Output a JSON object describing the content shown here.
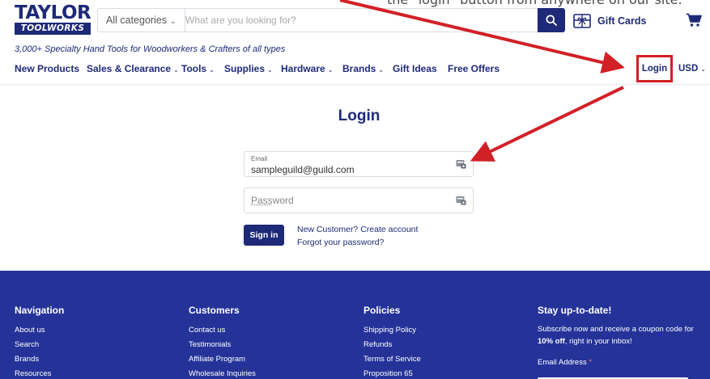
{
  "brand": {
    "logo_top": "TAYLOR",
    "logo_bottom": "TOOLWORKS",
    "tagline": "3,000+ Specialty Hand Tools for Woodworkers & Crafters of all types"
  },
  "search": {
    "category_label": "All categories",
    "placeholder": "What are you looking for?"
  },
  "header": {
    "gift_cards_label": "Gift Cards",
    "login_label": "Login",
    "currency_label": "USD"
  },
  "tip": {
    "text": "the \"login\" button from anywhere on our site."
  },
  "nav": {
    "items": [
      {
        "label": "New Products"
      },
      {
        "label": "Sales & Clearance"
      },
      {
        "label": "Tools"
      },
      {
        "label": "Supplies"
      },
      {
        "label": "Hardware"
      },
      {
        "label": "Brands"
      },
      {
        "label": "Gift Ideas"
      },
      {
        "label": "Free Offers"
      }
    ]
  },
  "login": {
    "title": "Login",
    "email_label": "Email",
    "email_value": "sampleguild@guild.com",
    "password_placeholder_underlined": "Pass",
    "password_placeholder_rest": "word",
    "sign_in_label": "Sign in",
    "new_customer_prompt": "New Customer?",
    "create_account_label": "Create account",
    "forgot_password_label": "Forgot your password?"
  },
  "footer": {
    "navigation": {
      "title": "Navigation",
      "links": [
        "About us",
        "Search",
        "Brands",
        "Resources"
      ]
    },
    "customers": {
      "title": "Customers",
      "links": [
        "Contact us",
        "Testimonials",
        "Affiliate Program",
        "Wholesale Inquiries"
      ]
    },
    "policies": {
      "title": "Policies",
      "links": [
        "Shipping Policy",
        "Refunds",
        "Terms of Service",
        "Proposition 65"
      ]
    },
    "newsletter": {
      "title": "Stay up-to-date!",
      "text_before": "Subscribe now and receive a coupon code for",
      "text_bold": "10% off",
      "text_after": ", right in your inbox!",
      "email_label": "Email Address",
      "required_mark": "*"
    }
  },
  "colors": {
    "brand_navy": "#1e2a78",
    "footer_blue": "#253399",
    "annotation_red": "#d22027"
  }
}
